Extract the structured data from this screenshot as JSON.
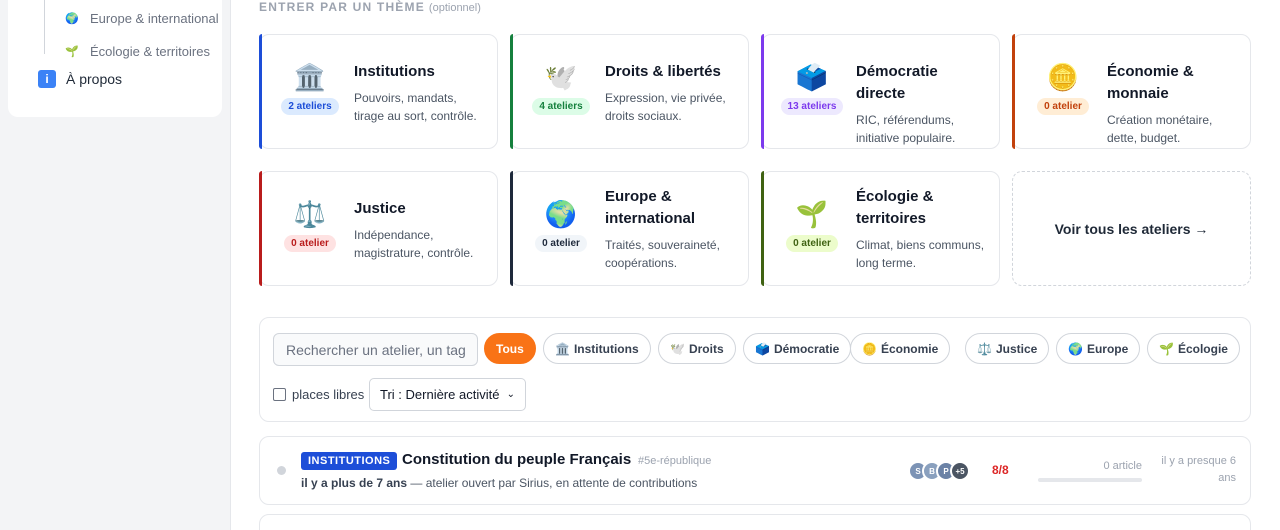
{
  "sidebar": {
    "subitems": [
      {
        "icon": "globe-icon",
        "glyph": "🌍",
        "label": "Europe & international"
      },
      {
        "icon": "seedling-icon",
        "glyph": "🌱",
        "label": "Écologie & territoires"
      }
    ],
    "about": {
      "icon": "info-icon",
      "glyph": "i",
      "label": "À propos"
    }
  },
  "main": {
    "section_title": "ENTRER PAR UN THÈME",
    "section_optional": "(optionnel)",
    "themes": [
      {
        "glyph": "🏛️",
        "icon": "institution-icon",
        "title": "Institutions",
        "desc": "Pouvoirs, mandats, tirage au sort, contrôle.",
        "badge": "2 ateliers",
        "accent": "#1d4ed8",
        "badge_bg": "#dbeafe",
        "badge_fg": "#1d4ed8"
      },
      {
        "glyph": "🕊️",
        "icon": "dove-icon",
        "title": "Droits & libertés",
        "desc": "Expression, vie privée, droits sociaux.",
        "badge": "4 ateliers",
        "accent": "#15803d",
        "badge_bg": "#dcfce7",
        "badge_fg": "#15803d"
      },
      {
        "glyph": "🗳️",
        "icon": "ballot-box-icon",
        "title": "Démocratie directe",
        "desc": "RIC, référendums, initiative populaire.",
        "badge": "13 ateliers",
        "accent": "#7c3aed",
        "badge_bg": "#ede9fe",
        "badge_fg": "#7c3aed"
      },
      {
        "glyph": "🪙",
        "icon": "coin-icon",
        "title": "Économie & monnaie",
        "desc": "Création monétaire, dette, budget.",
        "badge": "0 atelier",
        "accent": "#c2410c",
        "badge_bg": "#ffedd5",
        "badge_fg": "#c2410c"
      },
      {
        "glyph": "⚖️",
        "icon": "scales-icon",
        "title": "Justice",
        "desc": "Indépendance, magistrature, contrôle.",
        "badge": "0 atelier",
        "accent": "#b91c1c",
        "badge_bg": "#fee2e2",
        "badge_fg": "#b91c1c"
      },
      {
        "glyph": "🌍",
        "icon": "globe-icon",
        "title": "Europe & international",
        "desc": "Traités, souveraineté, coopérations.",
        "badge": "0 atelier",
        "accent": "#1e293b",
        "badge_bg": "#f1f5f9",
        "badge_fg": "#1e293b"
      },
      {
        "glyph": "🌱",
        "icon": "seedling-icon",
        "title": "Écologie & territoires",
        "desc": "Climat, biens communs, long terme.",
        "badge": "0 atelier",
        "accent": "#3f6212",
        "badge_bg": "#ecfccb",
        "badge_fg": "#3f6212"
      }
    ],
    "see_all": "Voir tous les ateliers →"
  },
  "filters": {
    "search_placeholder": "Rechercher un atelier, un tag",
    "chips": [
      {
        "label": "Tous",
        "glyph": "",
        "icon": "",
        "active": true
      },
      {
        "label": "Institutions",
        "glyph": "🏛️",
        "icon": "institution-icon",
        "active": false
      },
      {
        "label": "Droits",
        "glyph": "🕊️",
        "icon": "dove-icon",
        "active": false
      },
      {
        "label": "Démocratie",
        "glyph": "🗳️",
        "icon": "ballot-box-icon",
        "active": false
      },
      {
        "label": "Économie",
        "glyph": "🪙",
        "icon": "coin-icon",
        "active": false
      },
      {
        "label": "Justice",
        "glyph": "⚖️",
        "icon": "scales-icon",
        "active": false
      },
      {
        "label": "Europe",
        "glyph": "🌍",
        "icon": "globe-icon",
        "active": false
      },
      {
        "label": "Écologie",
        "glyph": "🌱",
        "icon": "seedling-icon",
        "active": false
      }
    ],
    "places_libres": "places libres",
    "sort_label": "Tri : Dernière activité"
  },
  "workshops": [
    {
      "tag": "INSTITUTIONS",
      "title": "Constitution du peuple Français",
      "hashtag": "#5e-république",
      "age": "il y a plus de 7 ans",
      "meta": " — atelier ouvert par Sirius, en attente de contributions",
      "avatars": [
        {
          "letter": "S",
          "color": "#7c93b5"
        },
        {
          "letter": "B",
          "color": "#8aa0be"
        },
        {
          "letter": "P",
          "color": "#6b82a6"
        },
        {
          "letter": "+5",
          "color": "#4b5563"
        }
      ],
      "count": "8/8",
      "articles": "0 article",
      "progress": 0,
      "time": "il y a presque 6 ans"
    }
  ]
}
